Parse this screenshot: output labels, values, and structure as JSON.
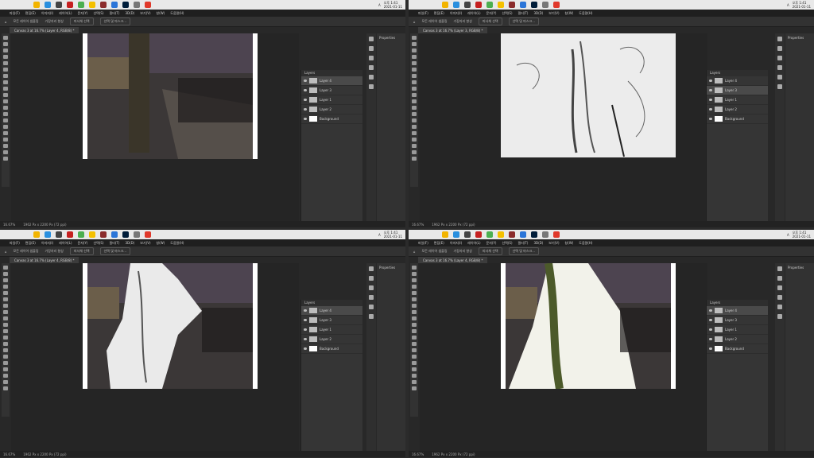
{
  "tray": {
    "lang": "A",
    "time": "오후 1:41",
    "date": "2021-01-11"
  },
  "menu": [
    "파일(F)",
    "편집(E)",
    "이미지(I)",
    "레이어(L)",
    "문자(Y)",
    "선택(S)",
    "필터(T)",
    "3D(D)",
    "보기(V)",
    "창(W)",
    "도움말(H)"
  ],
  "options": {
    "sample_all": "모든 레이어 샘플링",
    "enhance": "가장자리 향상",
    "subject": "피사체 선택",
    "mask": "선택 및 마스크..."
  },
  "quads": [
    {
      "doc_tab": "Canvas 3 at 16.7% (Layer 4, RGB/8) *",
      "status_zoom": "16.67%",
      "status_size": "1962 Px x 2200 Px (72 ppi)",
      "panel_title": "Layers",
      "layers": [
        "Layer 4",
        "Layer 3",
        "Layer 1",
        "Layer 2",
        "Background"
      ],
      "selected": 0,
      "image": "street"
    },
    {
      "doc_tab": "Canvas 3 at 16.7% (Layer 3, RGB/8) *",
      "status_zoom": "16.67%",
      "status_size": "1962 Px x 2200 Px (72 ppi)",
      "panel_title": "Layers",
      "layers": [
        "Layer 4",
        "Layer 3",
        "Layer 1",
        "Layer 2",
        "Background"
      ],
      "selected": 1,
      "image": "sketch"
    },
    {
      "doc_tab": "Canvas 3 at 16.7% (Layer 4, RGB/8) *",
      "status_zoom": "16.67%",
      "status_size": "1962 Px x 2200 Px (72 ppi)",
      "panel_title": "Layers",
      "layers": [
        "Layer 4",
        "Layer 3",
        "Layer 1",
        "Layer 2",
        "Background"
      ],
      "selected": 0,
      "image": "mixed"
    },
    {
      "doc_tab": "Canvas 3 at 16.7% (Layer 4, RGB/8) *",
      "status_zoom": "16.67%",
      "status_size": "1962 Px x 2200 Px (72 ppi)",
      "panel_title": "Layers",
      "layers": [
        "Layer 4",
        "Layer 3",
        "Layer 1",
        "Layer 2",
        "Background"
      ],
      "selected": 0,
      "image": "mixed2"
    }
  ],
  "props": {
    "title": "Properties"
  }
}
